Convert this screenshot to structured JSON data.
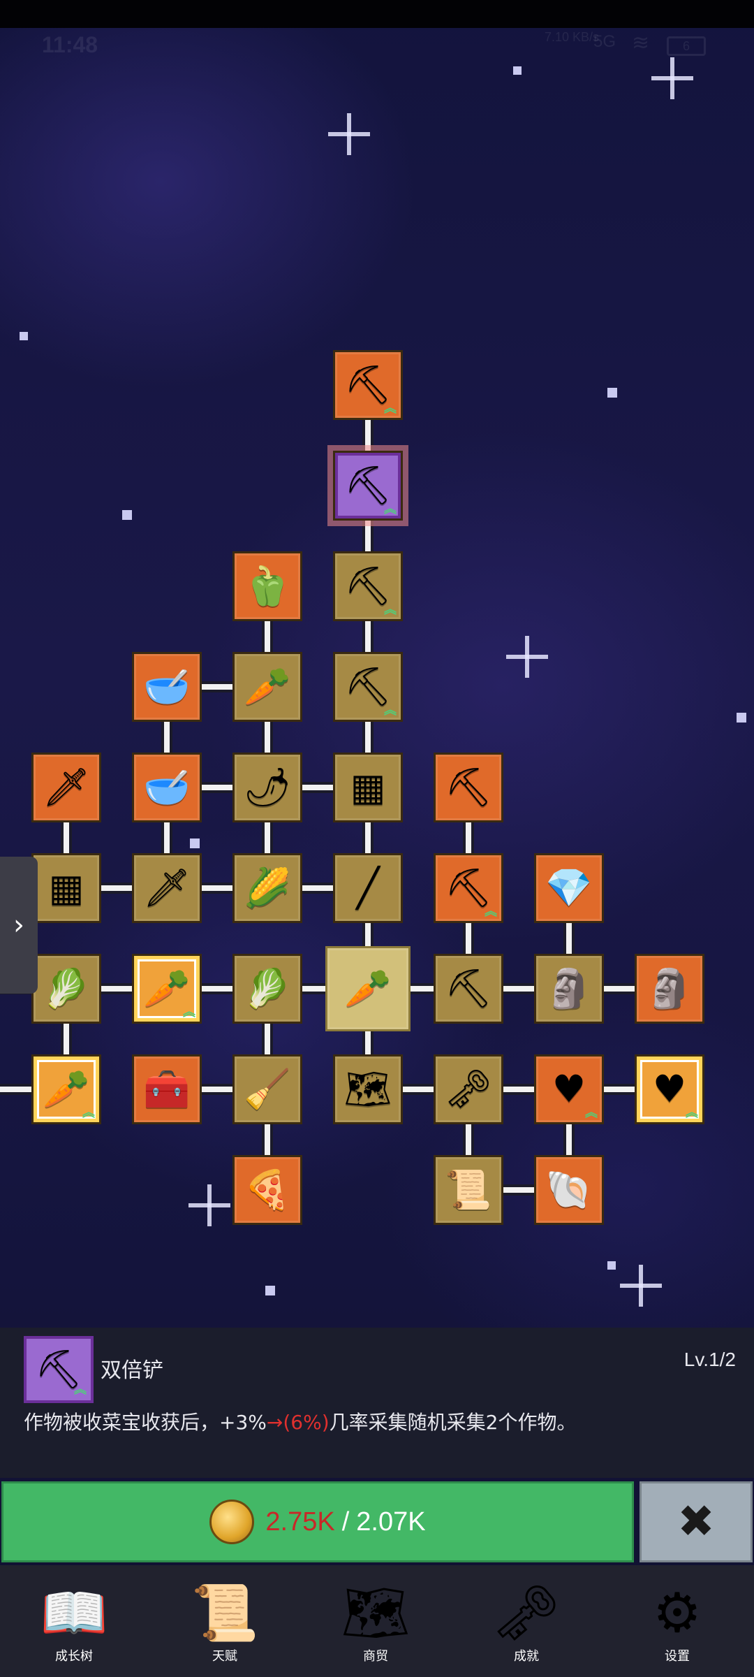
{
  "status_bar": {
    "time": "11:48",
    "net_speed": "7.10 KB/s",
    "signal": "5G",
    "battery": "6"
  },
  "tree": {
    "nodes": [
      {
        "id": "shovel-top",
        "icon": "shovel-icon",
        "glyph": "⛏",
        "style": "orange",
        "up": true
      },
      {
        "id": "double-shovel",
        "icon": "shovel-icon",
        "glyph": "⛏",
        "style": "purple",
        "up": true
      },
      {
        "id": "pepper",
        "icon": "bell-pepper-icon",
        "glyph": "🫑",
        "style": "orange",
        "up": false
      },
      {
        "id": "shovel-3",
        "icon": "shovel-icon",
        "glyph": "⛏",
        "style": "gold",
        "up": true
      },
      {
        "id": "bowl-1",
        "icon": "bowl-icon",
        "glyph": "🥣",
        "style": "orange",
        "up": false
      },
      {
        "id": "radish",
        "icon": "radish-icon",
        "glyph": "🥕",
        "style": "gold",
        "up": false
      },
      {
        "id": "shovel-4",
        "icon": "shovel-icon",
        "glyph": "⛏",
        "style": "gold",
        "up": true
      },
      {
        "id": "sword-1",
        "icon": "sword-icon",
        "glyph": "🗡",
        "style": "orange",
        "up": false
      },
      {
        "id": "bowl-2",
        "icon": "bowl-icon",
        "glyph": "🥣",
        "style": "orange",
        "up": false
      },
      {
        "id": "chili",
        "icon": "chili-icon",
        "glyph": "🌶",
        "style": "gold",
        "up": false
      },
      {
        "id": "crate-1",
        "icon": "crate-icon",
        "glyph": "▦",
        "style": "gold",
        "up": false
      },
      {
        "id": "pickaxe-1",
        "icon": "pickaxe-icon",
        "glyph": "⛏",
        "style": "orange",
        "up": false
      },
      {
        "id": "crate-2",
        "icon": "crate-icon",
        "glyph": "▦",
        "style": "gold",
        "up": false
      },
      {
        "id": "sword-2",
        "icon": "sword-icon",
        "glyph": "🗡",
        "style": "gold",
        "up": false
      },
      {
        "id": "corn",
        "icon": "corn-icon",
        "glyph": "🌽",
        "style": "gold",
        "up": false
      },
      {
        "id": "wand",
        "icon": "wand-icon",
        "glyph": "╱",
        "style": "gold",
        "up": false
      },
      {
        "id": "pickaxe-2",
        "icon": "pickaxe-icon",
        "glyph": "⛏",
        "style": "orange",
        "up": true
      },
      {
        "id": "crystal",
        "icon": "crystal-icon",
        "glyph": "💎",
        "style": "orange",
        "up": false
      },
      {
        "id": "cabbage-1",
        "icon": "cabbage-icon",
        "glyph": "🥬",
        "style": "gold",
        "up": false
      },
      {
        "id": "carrot-rare-1",
        "icon": "carrot-icon",
        "glyph": "🥕",
        "style": "rare",
        "up": true
      },
      {
        "id": "cabbage-2",
        "icon": "cabbage-icon",
        "glyph": "🥬",
        "style": "gold",
        "up": false
      },
      {
        "id": "carrot-center",
        "icon": "carrot-icon",
        "glyph": "🥕",
        "style": "selected",
        "up": false
      },
      {
        "id": "pickaxe-3",
        "icon": "pickaxe-icon",
        "glyph": "⛏",
        "style": "gold",
        "up": false
      },
      {
        "id": "statue-1",
        "icon": "statue-icon",
        "glyph": "🗿",
        "style": "gold",
        "up": false
      },
      {
        "id": "statue-2",
        "icon": "statue-icon",
        "glyph": "🗿",
        "style": "orange",
        "up": false
      },
      {
        "id": "carrot-rare-2",
        "icon": "carrot-icon",
        "glyph": "🥕",
        "style": "rare",
        "up": true
      },
      {
        "id": "chest",
        "icon": "chest-icon",
        "glyph": "🧰",
        "style": "orange",
        "up": false
      },
      {
        "id": "broom",
        "icon": "broom-icon",
        "glyph": "🧹",
        "style": "gold",
        "up": false
      },
      {
        "id": "map-node",
        "icon": "map-icon",
        "glyph": "🗺",
        "style": "gold",
        "up": false
      },
      {
        "id": "key-node",
        "icon": "key-icon",
        "glyph": "🗝",
        "style": "gold",
        "up": false
      },
      {
        "id": "heart-1",
        "icon": "heart-icon",
        "glyph": "♥",
        "style": "orange",
        "up": true
      },
      {
        "id": "heart-2",
        "icon": "heart-icon",
        "glyph": "♥",
        "style": "rare",
        "up": true
      },
      {
        "id": "pizza",
        "icon": "pizza-icon",
        "glyph": "🍕",
        "style": "orange",
        "up": false
      },
      {
        "id": "scroll",
        "icon": "scroll-icon",
        "glyph": "📜",
        "style": "gold",
        "up": false
      },
      {
        "id": "fossil",
        "icon": "fossil-icon",
        "glyph": "🐚",
        "style": "orange",
        "up": false
      }
    ]
  },
  "detail": {
    "icon": "shovel-icon",
    "icon_glyph": "⛏",
    "name": "双倍铲",
    "level": "Lv.1/2",
    "desc_prefix": "作物被收菜宝收获后，+3%",
    "desc_arrow": "→(6%)",
    "desc_suffix": "几率采集随机采集2个作物。"
  },
  "cost": {
    "coin_icon": "coin-icon",
    "have": "2.75K",
    "sep": "/",
    "need": "2.07K"
  },
  "close_glyph": "✖",
  "side_tab_glyph": "›",
  "nav": [
    {
      "label": "成长树",
      "icon": "book-icon",
      "glyph": "📖"
    },
    {
      "label": "天赋",
      "icon": "scroll-icon",
      "glyph": "📜"
    },
    {
      "label": "商贸",
      "icon": "map-icon",
      "glyph": "🗺"
    },
    {
      "label": "成就",
      "icon": "key-icon",
      "glyph": "🗝"
    },
    {
      "label": "设置",
      "icon": "gear-icon",
      "glyph": "⚙"
    }
  ],
  "colors": {
    "accent_green": "#43b866",
    "highlight_red": "#e0302e",
    "gold_tile": "#a68a45",
    "orange_tile": "#e06a2a",
    "purple_tile": "#9a6ad0"
  }
}
